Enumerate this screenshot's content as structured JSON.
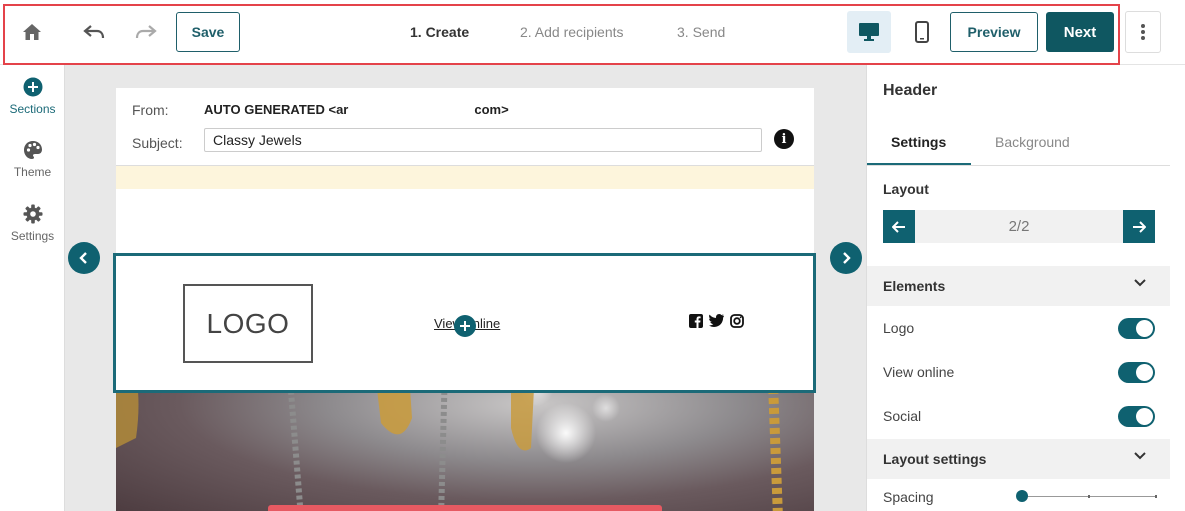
{
  "topbar": {
    "save_label": "Save",
    "steps": [
      {
        "label": "1. Create",
        "active": true
      },
      {
        "label": "2. Add recipients",
        "active": false
      },
      {
        "label": "3. Send",
        "active": false
      }
    ],
    "preview_label": "Preview",
    "next_label": "Next",
    "icons": [
      "home-icon",
      "undo-icon",
      "redo-icon",
      "desktop-icon",
      "mobile-icon",
      "more-vertical-icon"
    ]
  },
  "leftnav": {
    "items": [
      {
        "label": "Sections",
        "icon": "plus-circle-icon",
        "active": true
      },
      {
        "label": "Theme",
        "icon": "palette-icon",
        "active": false
      },
      {
        "label": "Settings",
        "icon": "gear-icon",
        "active": false
      }
    ]
  },
  "email": {
    "from_label": "From:",
    "from_value_start": "AUTO GENERATED <ar",
    "from_value_end": "com>",
    "subject_label": "Subject:",
    "subject_value": "Classy Jewels",
    "header": {
      "logo_text": "LOGO",
      "view_online": "View online",
      "social_icons": [
        "facebook-icon",
        "twitter-icon",
        "instagram-icon"
      ]
    }
  },
  "panel": {
    "title": "Header",
    "tabs": [
      {
        "label": "Settings",
        "active": true
      },
      {
        "label": "Background",
        "active": false
      }
    ],
    "layout_label": "Layout",
    "layout_value": "2/2",
    "elements_label": "Elements",
    "elements": [
      {
        "label": "Logo",
        "enabled": true
      },
      {
        "label": "View online",
        "enabled": true
      },
      {
        "label": "Social",
        "enabled": true
      }
    ],
    "layout_settings_label": "Layout settings",
    "spacing_label": "Spacing",
    "spacing_level": 0
  },
  "colors": {
    "primary": "#0f6170",
    "primary_dark": "#0f5761",
    "highlight_red": "#e4434a",
    "hero_button": "#e65a62"
  }
}
